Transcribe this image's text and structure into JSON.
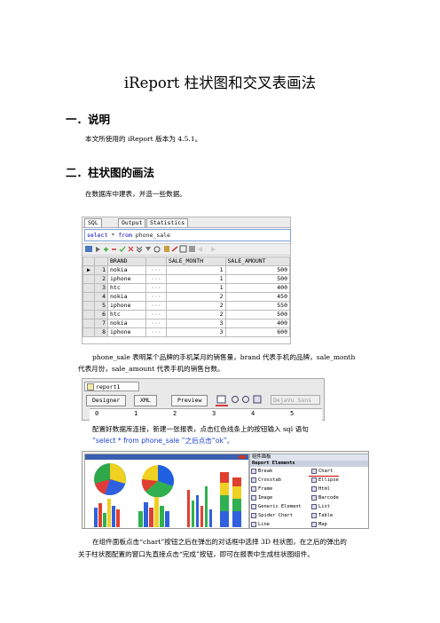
{
  "title": "iReport 柱状图和交叉表画法",
  "section1": {
    "heading": "一．说明",
    "text": "本文所使用的 iReport 版本为 4.5.1。"
  },
  "section2": {
    "heading": "二．柱状图的画法",
    "intro": "在数据库中建表，并造一些数据。"
  },
  "sql_screenshot": {
    "tabs": [
      "SQL",
      "Output",
      "Statistics"
    ],
    "query_kw1": "select",
    "query_star": " * ",
    "query_kw2": "from",
    "query_table": " phone_sale",
    "columns": [
      "BRAND",
      "SALE_MONTH",
      "SALE_AMOUNT"
    ],
    "rows": [
      [
        "1",
        "nokia",
        "1",
        "500"
      ],
      [
        "2",
        "iphone",
        "1",
        "500"
      ],
      [
        "3",
        "htc",
        "1",
        "400"
      ],
      [
        "4",
        "nokia",
        "2",
        "450"
      ],
      [
        "5",
        "iphone",
        "2",
        "550"
      ],
      [
        "6",
        "htc",
        "2",
        "500"
      ],
      [
        "7",
        "nokia",
        "3",
        "400"
      ],
      [
        "8",
        "iphone",
        "3",
        "600"
      ]
    ],
    "cell_dots": "···"
  },
  "explain_para_line1": "phone_sale 表明某个品牌的手机某月的销售量，brand 代表手机的品牌，sale_month",
  "explain_para_line2": "代表月份，sale_amount 代表手机的销售台数。",
  "ireport_screenshot": {
    "tab": "report1",
    "buttons": [
      "Designer",
      "XML",
      "Preview"
    ],
    "font": "DejaVu Sans",
    "ruler": [
      "0",
      "1",
      "2",
      "3",
      "4",
      "5"
    ]
  },
  "config_para_line1": "配置好数据库连接，新建一张报表，点击红色线条上的按钮输入 sql 语句",
  "config_para_line2": "“select   *   from phone_sale ”之后点击“ok”。",
  "palette_screenshot": {
    "title": "组件面板",
    "section": "Report Elements",
    "items": [
      "Break",
      "Chart",
      "Crosstab",
      "Ellipse",
      "Frame",
      "Html",
      "Image",
      "Barcode",
      "Generic Element",
      "List",
      "Spider Chart",
      "Table",
      "Line",
      "Map"
    ]
  },
  "closing_para_line1": "在组件面板点击“chart”按钮之后在弹出的对话框中选择 3D 柱状图，在之后的弹出的",
  "closing_para_line2": "关于柱状图配置的窗口先直接点击“完成”按钮，即可在报表中生成柱状图组件。",
  "colors": {
    "accent_red": "#d40000",
    "link_blue": "#1a3fd6",
    "grid_header": "#e4e4e4"
  }
}
